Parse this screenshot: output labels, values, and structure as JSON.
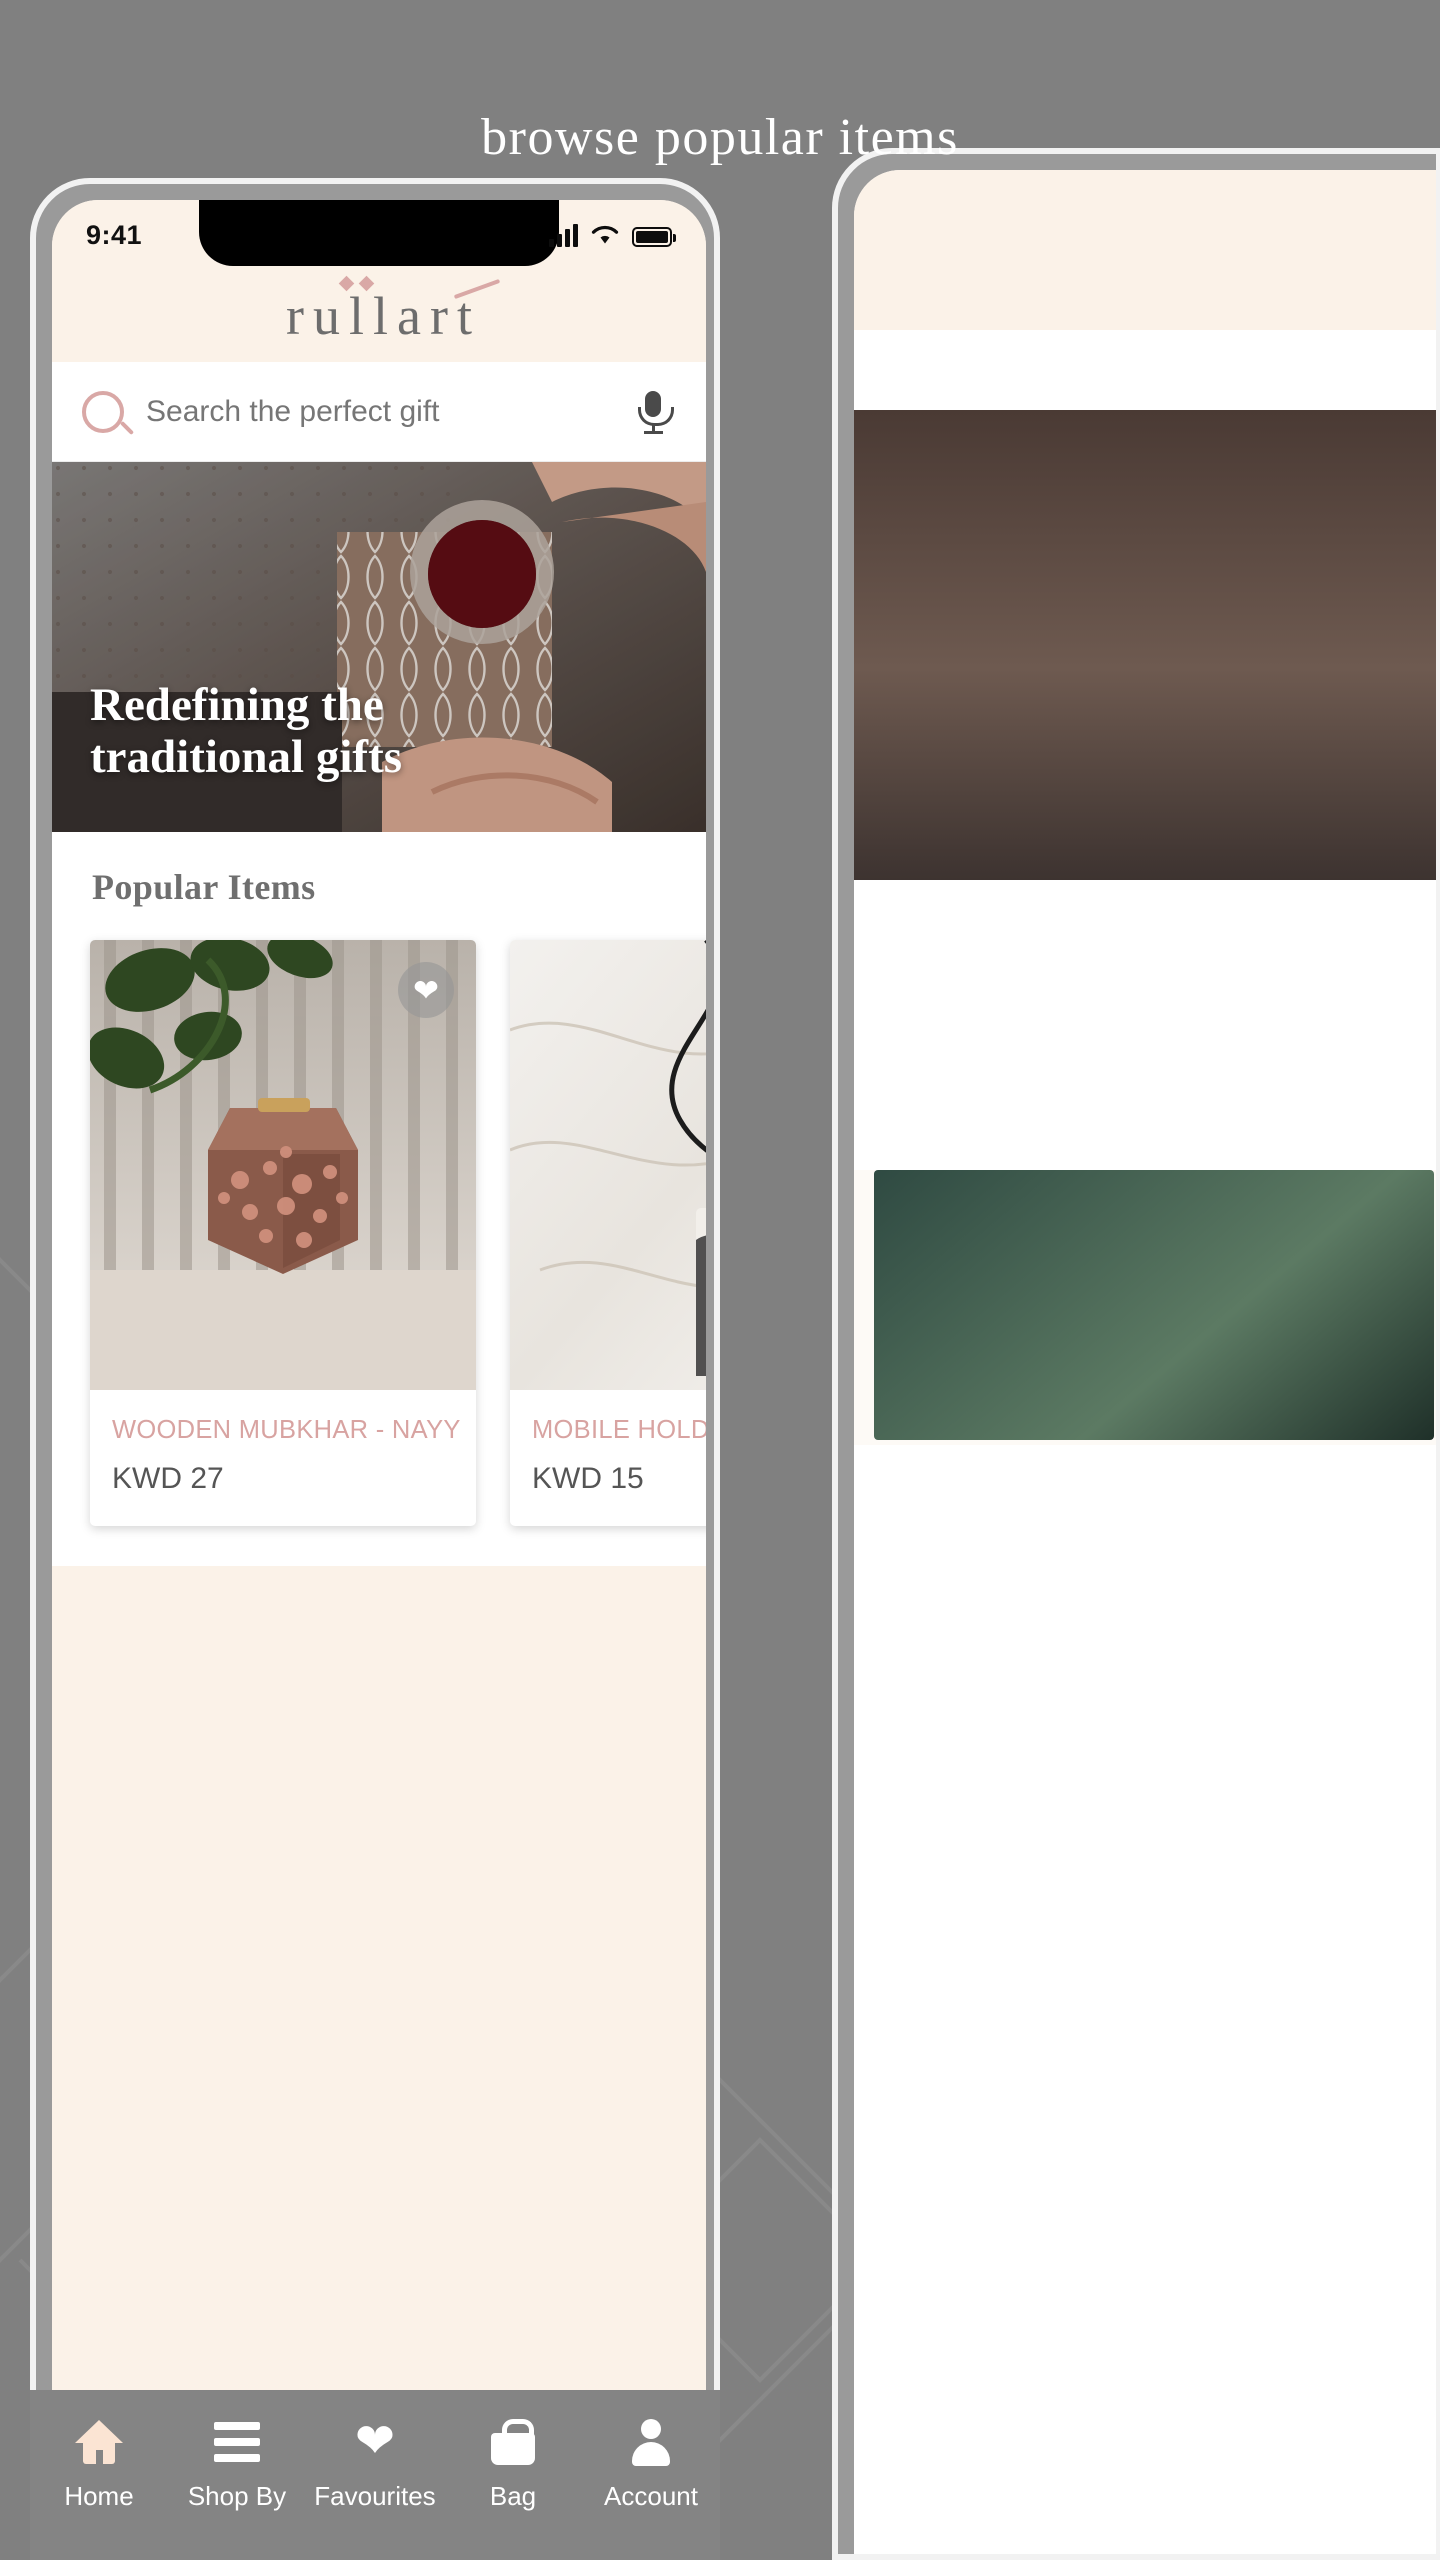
{
  "page": {
    "headline": "browse popular items",
    "background_color": "#808080"
  },
  "phone": {
    "status_bar": {
      "time": "9:41",
      "signal_icon": "cellular-bars-icon",
      "wifi_icon": "wifi-icon",
      "battery_icon": "battery-full-icon"
    },
    "header": {
      "logo_text": "rüllárt",
      "logo_color": "#6d6d6d",
      "accent_color": "#d9a8a6",
      "background_color": "#fbf2e8"
    },
    "search": {
      "placeholder": "Search the perfect gift",
      "search_icon": "search-icon",
      "mic_icon": "microphone-icon"
    },
    "hero": {
      "title_line1": "Redefining the",
      "title_line2": "traditional gifts"
    },
    "popular": {
      "section_title": "Popular Items",
      "items": [
        {
          "name": "WOODEN MUBKHAR - NAYY",
          "price": "KWD 27",
          "favourite_icon": "heart-icon",
          "favourited": true
        },
        {
          "name": "MOBILE HOLDER",
          "price": "KWD 15",
          "favourite_icon": "heart-icon",
          "favourited": false
        }
      ]
    },
    "tabbar": {
      "items": [
        {
          "label": "Home",
          "icon": "home-icon",
          "active": true
        },
        {
          "label": "Shop By",
          "icon": "menu-icon",
          "active": false
        },
        {
          "label": "Favourites",
          "icon": "heart-icon",
          "active": false
        },
        {
          "label": "Bag",
          "icon": "shopping-bag-icon",
          "active": false
        },
        {
          "label": "Account",
          "icon": "account-icon",
          "active": false
        }
      ]
    }
  }
}
